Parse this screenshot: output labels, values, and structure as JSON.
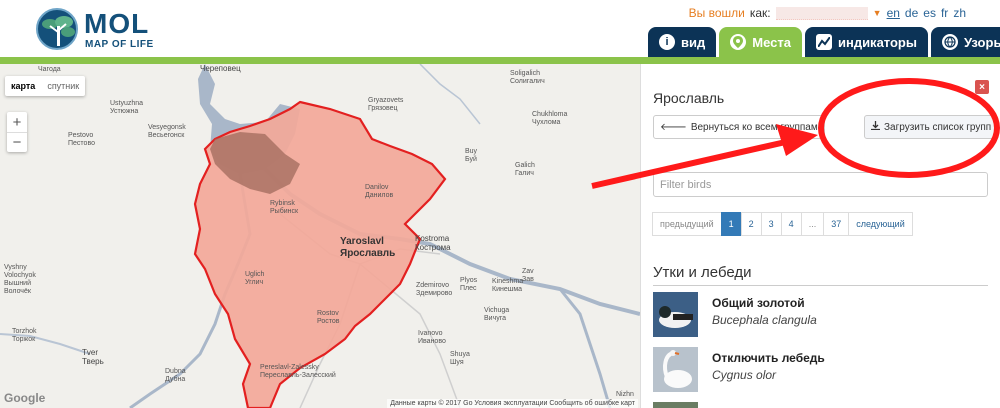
{
  "header": {
    "logo_big": "MOL",
    "logo_small": "MAP OF LIFE",
    "login_label": "Вы вошли",
    "as_label": "как:",
    "languages": [
      "en",
      "de",
      "es",
      "fr",
      "zh"
    ]
  },
  "tabs": [
    {
      "label": "вид",
      "icon": "info-icon"
    },
    {
      "label": "Места",
      "icon": "map-pin-icon"
    },
    {
      "label": "индикаторы",
      "icon": "chart-icon"
    },
    {
      "label": "Узоры",
      "icon": "globe-icon"
    }
  ],
  "map": {
    "type_map": "карта",
    "type_satellite": "спутник",
    "zoom_in": "+",
    "zoom_out": "−",
    "google": "Google",
    "attribution": "Данные карты © 2017 Go  Условия эксплуатации  Сообщить об ошибке карт",
    "labels": {
      "chagoda": "Чагода",
      "cherepovets": "Череповец",
      "soligalich": "Soligalich\nСолигалич",
      "ustyuzhna": "Ustyuzhna\nУстюжна",
      "gryazovets": "Gryazovets\nГрязовец",
      "chukhloma": "Chukhloma\nЧухлома",
      "vesyegonsk": "Vesyegonsk\nВесьегонск",
      "pestovo": "Pestovo\nПестово",
      "buy": "Buy\nБуй",
      "galich": "Galich\nГалич",
      "danilov": "Danilov\nДанилов",
      "rybinsk": "Rybinsk\nРыбинск",
      "yaroslavl": "Yaroslavl\nЯрославль",
      "kostroma": "Kostroma\nКострома",
      "uglich": "Uglich\nУглич",
      "plyos": "Plyos\nПлес",
      "zavolzhsk": "Zav\nЗав",
      "kineshma": "Kineshma\nКинешма",
      "zdemirovo": "Zdemirovo\nЗдемирово",
      "rostov": "Rostov\nРостов",
      "vichuga": "Vichuga\nВичуга",
      "vyshny": "Vyshny\nVolochyok\nВышний\nВолочёк",
      "torzhok": "Torzhok\nТоржок",
      "tver": "Tver\nТверь",
      "ivanovo": "Ivanovo\nИваново",
      "shuya": "Shuya\nШуя",
      "pereslavl": "Pereslavl-Zalessky\nПереславль-Залесский",
      "dubna": "Dubna\nДубна",
      "nizhn": "Nizhn"
    }
  },
  "panel": {
    "close": "×",
    "title": "Ярославль",
    "back_button": "Вернуться ко всем группам",
    "download_button": "Загрузить список групп",
    "filter_placeholder": "Filter birds",
    "pager": [
      "предыдущий",
      "1",
      "2",
      "3",
      "4",
      "...",
      "37",
      "следующий"
    ],
    "section_title": "Утки и лебеди",
    "species": [
      {
        "name": "Общий золотой",
        "latin": "Bucephala clangula"
      },
      {
        "name": "Отключить лебедь",
        "latin": "Cygnus olor"
      }
    ]
  },
  "colors": {
    "navy": "#0c3356",
    "green": "#8bc34a",
    "region_fill": "#f3a899",
    "region_stroke": "#e32020",
    "annotation": "#ff1a1a"
  }
}
